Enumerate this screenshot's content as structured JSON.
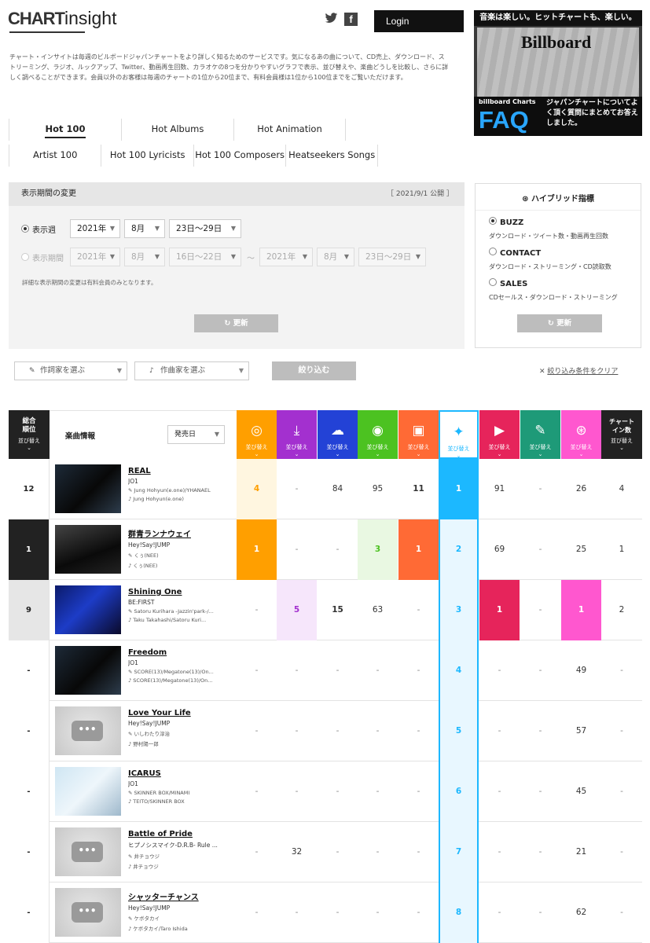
{
  "header": {
    "logo": {
      "chart": "CHART",
      "insight": "insight"
    },
    "login_label": "Login",
    "login_arrow": "⇀"
  },
  "ad": {
    "top": "音楽は楽しい。ヒットチャートも、楽しい。",
    "billboard": "Billboard",
    "charts": "billboard Charts",
    "faq": "FAQ",
    "text": "ジャパンチャートについてよく頂く質問にまとめてお答えしました。"
  },
  "intro": "チャート・インサイトは毎週のビルボードジャパンチャートをより詳しく知るためのサービスです。気になるあの曲について、CD売上、ダウンロード、ストリーミング、ラジオ、ルックアップ、Twitter、動画再生回数、カラオケの8つを分かりやすいグラフで表示、並び替えや、楽曲どうしを比較し、さらに詳しく調べることができます。会員以外のお客様は毎週のチャートの1位から20位まで、有料会員様は1位から100位までをご覧いただけます。",
  "tabs": {
    "row1": [
      "Hot 100",
      "Hot Albums",
      "Hot Animation"
    ],
    "row2": [
      "Artist 100",
      "Hot 100 Lyricists",
      "Hot 100 Composers",
      "Heatseekers Songs"
    ]
  },
  "period": {
    "title": "表示期間の変更",
    "published": "［ 2021/9/1 公開 ］",
    "week_label": "表示週",
    "range_label": "表示期間",
    "year": "2021年",
    "month": "8月",
    "days": "23日〜29日",
    "from_days": "16日〜22日",
    "tilde": "〜",
    "note": "詳細な表示期間の変更は有料会員のみとなります。",
    "update": "更新"
  },
  "hybrid": {
    "title": "ハイブリッド指標",
    "options": [
      {
        "label": "BUZZ",
        "sub": "ダウンロード・ツイート数・動画再生回数"
      },
      {
        "label": "CONTACT",
        "sub": "ダウンロード・ストリーミング・CD読取数"
      },
      {
        "label": "SALES",
        "sub": "CDセールス・ダウンロード・ストリーミング"
      }
    ],
    "update": "更新"
  },
  "filters": {
    "lyricist": "作詞家を選ぶ",
    "composer": "作曲家を選ぶ",
    "narrow": "絞り込む",
    "clear": "絞り込み条件をクリア"
  },
  "table": {
    "rank_header": "総合\n順位",
    "info_header": "楽曲情報",
    "sort_select": "発売日",
    "sort_label": "並び替え",
    "chart_in": "チャート\nイン数",
    "colors": [
      "#ff9f00",
      "#a330cf",
      "#2342d6",
      "#4cc221",
      "#ff6a35",
      "#1cb8ff",
      "#e6245b",
      "#1e9a78",
      "#ff57cf",
      "#222222"
    ],
    "col_icons": [
      "cd-icon",
      "download-icon",
      "streaming-icon",
      "radio-icon",
      "lookup-icon",
      "twitter-icon",
      "video-icon",
      "karaoke-icon",
      "hybrid-icon"
    ],
    "rows": [
      {
        "rank": "12",
        "title": "REAL",
        "artist": "JO1",
        "lyric": "Jung Hohyun(e.one)/YHANAEL",
        "music": "Jung Hohyun(e.one)",
        "vals": [
          "4",
          "-",
          "84",
          "95",
          "11",
          "1",
          "91",
          "-",
          "26",
          "4"
        ]
      },
      {
        "rank": "1",
        "title": "群青ランナウェイ",
        "artist": "Hey!Say!JUMP",
        "lyric": "くぅ(NEE)",
        "music": "くぅ(NEE)",
        "vals": [
          "1",
          "-",
          "-",
          "3",
          "1",
          "2",
          "69",
          "-",
          "25",
          "1"
        ]
      },
      {
        "rank": "9",
        "title": "Shining One",
        "artist": "BE:FIRST",
        "lyric": "Satoru Kurihara -Jazzin'park-/...",
        "music": "Taku Takahashi/Satoru Kuri...",
        "vals": [
          "-",
          "5",
          "15",
          "63",
          "-",
          "3",
          "1",
          "-",
          "1",
          "2"
        ]
      },
      {
        "rank": "-",
        "title": "Freedom",
        "artist": "JO1",
        "lyric": "SCORE(13)/Megatone(13)/On...",
        "music": "SCORE(13)/Megatone(13)/On...",
        "vals": [
          "-",
          "-",
          "-",
          "-",
          "-",
          "4",
          "-",
          "-",
          "49",
          "-"
        ]
      },
      {
        "rank": "-",
        "title": "Love Your Life",
        "artist": "Hey!Say!JUMP",
        "lyric": "いしわたり淳治",
        "music": "野村陽一郎",
        "vals": [
          "-",
          "-",
          "-",
          "-",
          "-",
          "5",
          "-",
          "-",
          "57",
          "-"
        ]
      },
      {
        "rank": "-",
        "title": "ICARUS",
        "artist": "JO1",
        "lyric": "SKINNER BOX/MINAMI",
        "music": "TEITO/SKINNER BOX",
        "vals": [
          "-",
          "-",
          "-",
          "-",
          "-",
          "6",
          "-",
          "-",
          "45",
          "-"
        ]
      },
      {
        "rank": "-",
        "title": "Battle of Pride",
        "artist": "ヒプノシスマイク-D.R.B- Rule ...",
        "lyric": "井チョウジ",
        "music": "井チョウジ",
        "vals": [
          "-",
          "32",
          "-",
          "-",
          "-",
          "7",
          "-",
          "-",
          "21",
          "-"
        ]
      },
      {
        "rank": "-",
        "title": "シャッターチャンス",
        "artist": "Hey!Say!JUMP",
        "lyric": "ケボタカイ",
        "music": "ケボタカイ/Taro Ishida",
        "vals": [
          "-",
          "-",
          "-",
          "-",
          "-",
          "8",
          "-",
          "-",
          "62",
          "-"
        ]
      }
    ]
  }
}
